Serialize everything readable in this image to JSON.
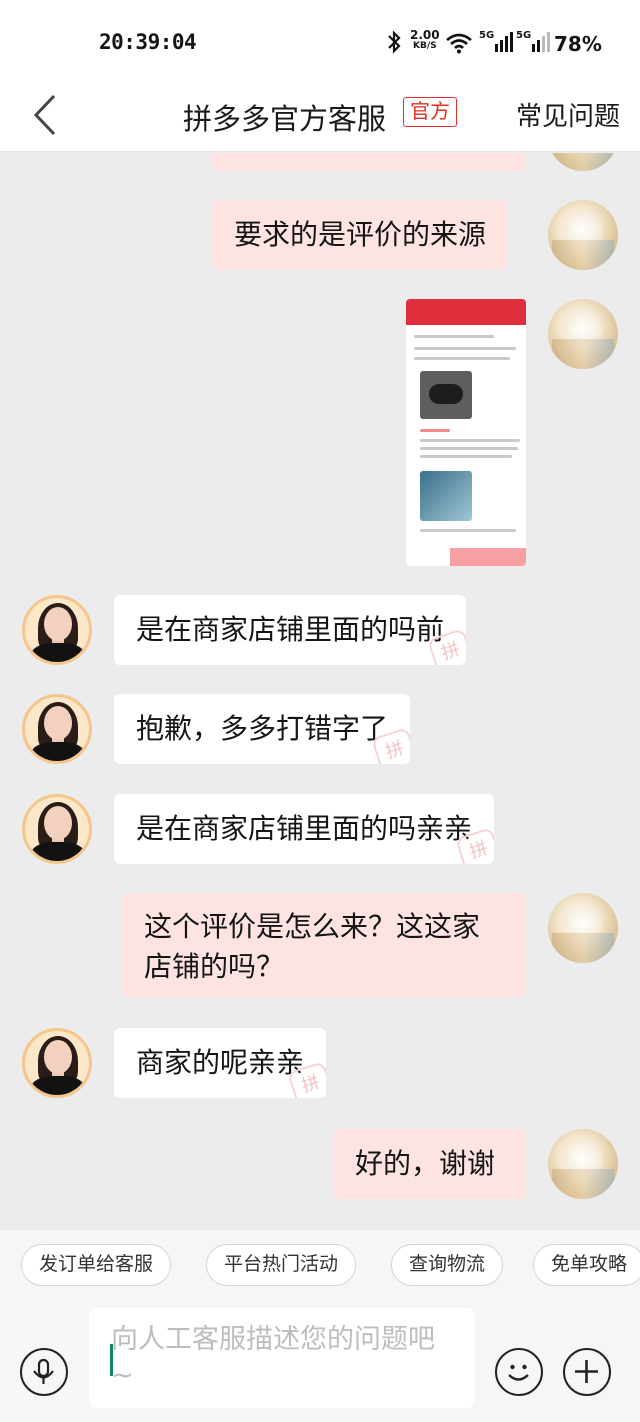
{
  "status_bar": {
    "time": "20:39:04",
    "network_speed": "2.00",
    "network_speed_unit": "KB/S",
    "signal_1": "5G",
    "signal_2": "5G",
    "battery": "78%"
  },
  "header": {
    "title": "拼多多官方客服",
    "badge": "官方",
    "faq_label": "常见问题"
  },
  "messages": [
    {
      "from": "user",
      "type": "text",
      "text": "要求的是评价的来源"
    },
    {
      "from": "user",
      "type": "image",
      "description": ""
    },
    {
      "from": "agent",
      "type": "text",
      "text": "是在商家店铺里面的吗前"
    },
    {
      "from": "agent",
      "type": "text",
      "text": "抱歉，多多打错字了"
    },
    {
      "from": "agent",
      "type": "text",
      "text": "是在商家店铺里面的吗亲亲"
    },
    {
      "from": "user",
      "type": "text",
      "text": "这个评价是怎么来？这这家店铺的吗？"
    },
    {
      "from": "agent",
      "type": "text",
      "text": "商家的呢亲亲"
    },
    {
      "from": "user",
      "type": "text",
      "text": "好的，谢谢"
    }
  ],
  "watermark_glyph": "拼",
  "quick_replies": [
    "发订单给客服",
    "平台热门活动",
    "查询物流",
    "免单攻略"
  ],
  "input": {
    "placeholder": "向人工客服描述您的问题吧 ~"
  },
  "icons": [
    "back-icon",
    "microphone-icon",
    "emoji-icon",
    "plus-icon"
  ],
  "colors": {
    "brand_red": "#e02e24",
    "outgoing_bubble": "#fde4e3",
    "incoming_bubble": "#ffffff",
    "chat_background": "#ececec"
  }
}
